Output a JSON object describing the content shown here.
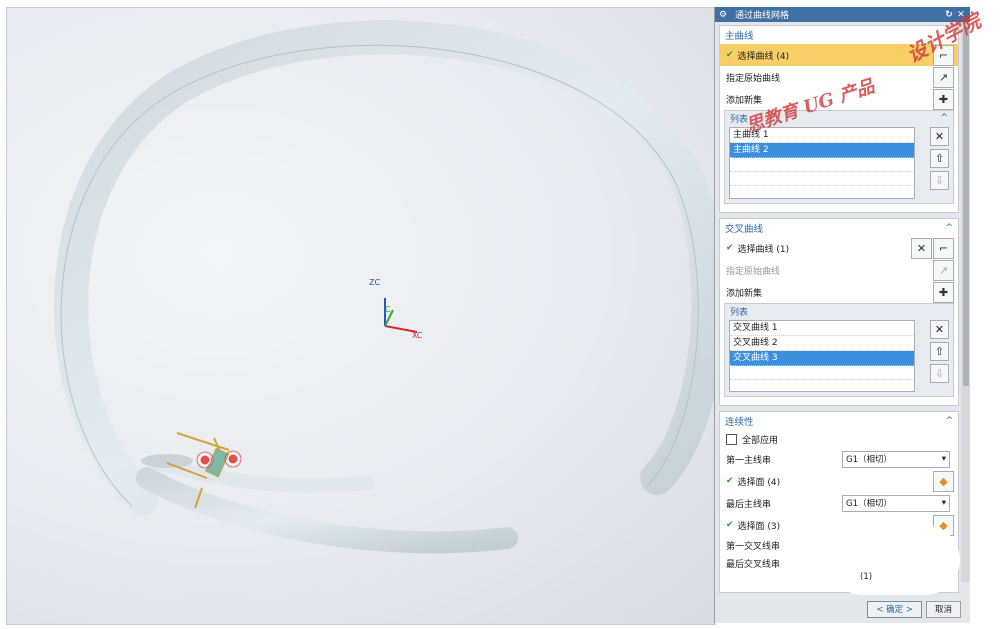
{
  "dialog": {
    "title": "通过曲线网格",
    "ok_label": "< 确定 >",
    "cancel_label": "取消"
  },
  "primary_curves": {
    "header": "主曲线",
    "select_label": "选择曲线 (4)",
    "specify_origin_label": "指定原始曲线",
    "add_set_label": "添加新集",
    "list_header": "列表",
    "items": [
      "主曲线 1",
      "主曲线 2"
    ],
    "selected_index": 1
  },
  "cross_curves": {
    "header": "交叉曲线",
    "select_label": "选择曲线 (1)",
    "specify_origin_label": "指定原始曲线",
    "add_set_label": "添加新集",
    "list_header": "列表",
    "items": [
      "交叉曲线 1",
      "交叉曲线 2",
      "交叉曲线 3"
    ],
    "selected_index": 2
  },
  "continuity": {
    "header": "连续性",
    "apply_all_label": "全部应用",
    "first_primary_label": "第一主线串",
    "first_primary_value": "G1（相切）",
    "first_face_label": "选择面 (4)",
    "last_primary_label": "最后主线串",
    "last_primary_value": "G1（相切）",
    "last_face_label": "选择面 (3)",
    "first_cross_label": "第一交叉线串",
    "last_cross_label": "最后交叉线串",
    "overlay_count": "(1)"
  },
  "triad": {
    "zc": "ZC",
    "xc": "XC",
    "yc": "C"
  },
  "watermark": {
    "line1": "设计学院",
    "line2": "思教育 UG 产品"
  },
  "colors": {
    "title_bar": "#3f6fa3",
    "accent": "#2b68a8",
    "selected_row": "#f7cf66",
    "list_selected": "#3c8fdc",
    "check": "#2aa12a"
  }
}
